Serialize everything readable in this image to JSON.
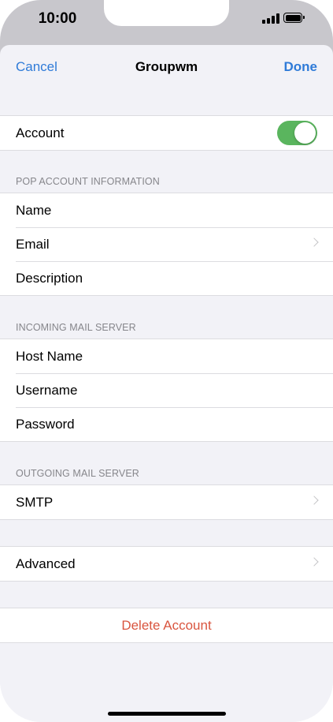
{
  "status_bar": {
    "time": "10:00",
    "signal_icon": "cellular-signal-icon",
    "battery_icon": "battery-full-icon"
  },
  "nav": {
    "cancel_label": "Cancel",
    "title": "Groupwm",
    "done_label": "Done"
  },
  "account": {
    "label": "Account",
    "toggle_on": true,
    "toggle_color": "#5ab55e"
  },
  "pop_section": {
    "header": "POP ACCOUNT INFORMATION",
    "rows": [
      {
        "label": "Name",
        "chevron": false
      },
      {
        "label": "Email",
        "chevron": true
      },
      {
        "label": "Description",
        "chevron": false
      }
    ]
  },
  "incoming_section": {
    "header": "INCOMING MAIL SERVER",
    "rows": [
      {
        "label": "Host Name"
      },
      {
        "label": "Username"
      },
      {
        "label": "Password"
      }
    ]
  },
  "outgoing_section": {
    "header": "OUTGOING MAIL SERVER",
    "rows": [
      {
        "label": "SMTP",
        "chevron": true
      }
    ]
  },
  "advanced": {
    "label": "Advanced",
    "chevron": true
  },
  "delete": {
    "label": "Delete Account",
    "color": "#d9553f"
  },
  "colors": {
    "accent": "#2f7bd8",
    "background": "#f2f2f7",
    "status_bar": "#c8c7cc"
  }
}
